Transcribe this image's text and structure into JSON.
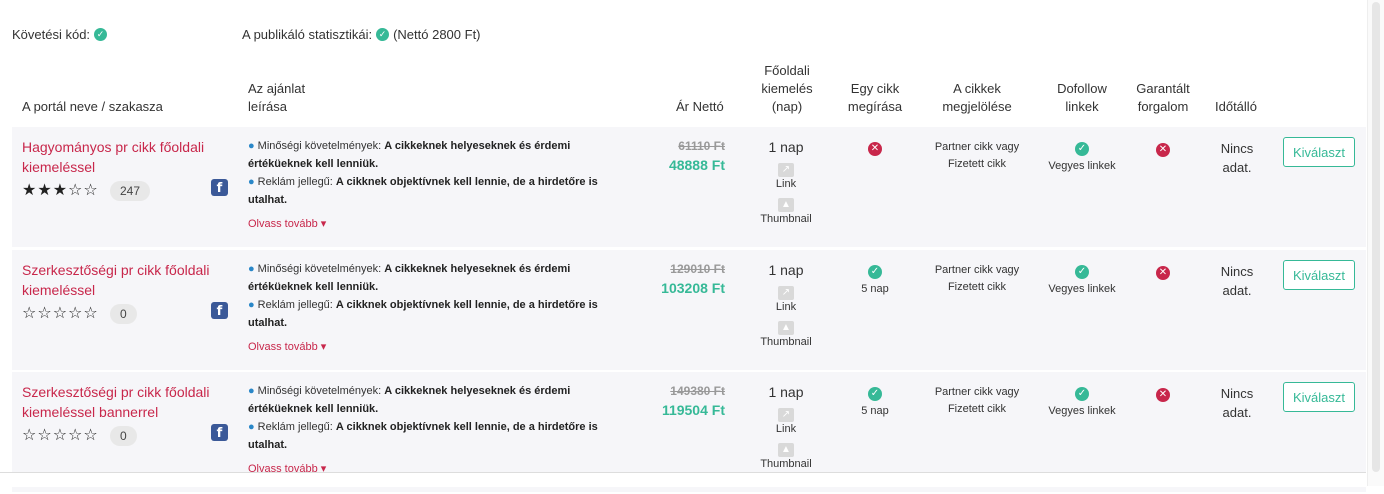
{
  "codes": {
    "tracking_label": "Követési kód:",
    "stats_label": "A publikáló statisztikái:",
    "stats_value": "(Nettó 2800 Ft)"
  },
  "headers": {
    "portal": "A portál neve / szakasza",
    "desc_line1": "Az ajánlat",
    "desc_line2": "leírása",
    "price": "Ár Nettó",
    "feat_line1": "Főoldali",
    "feat_line2": "kiemelés",
    "feat_line3": "(nap)",
    "write_line1": "Egy cikk",
    "write_line2": "megírása",
    "mark_line1": "A cikkek",
    "mark_line2": "megjelölése",
    "dofollow_line1": "Dofollow",
    "dofollow_line2": "linkek",
    "traffic_line1": "Garantált",
    "traffic_line2": "forgalom",
    "validity": "Időtálló"
  },
  "rows": [
    {
      "portal": "Hagyományos pr cikk főoldali kiemeléssel",
      "stars": "★★★☆☆",
      "rating_count": "247",
      "desc1_label": "Minőségi követelmények:",
      "desc1_text": "A cikkeknek helyeseknek és érdemi értéküeknek kell lenniük.",
      "desc2_label": "Reklám jellegű:",
      "desc2_text": "A cikknek objektívnek kell lennie, de a hirdetőre is utalhat.",
      "more": "Olvass tovább ▾",
      "price_old": "61110 Ft",
      "price_new": "48888 Ft",
      "feat_days": "1 nap",
      "feat_link": "Link",
      "feat_thumb": "Thumbnail",
      "write_status": "no",
      "write_days": "",
      "mark_line1": "Partner cikk vagy",
      "mark_line2": "Fizetett cikk",
      "dofollow_text": "Vegyes linkek",
      "validity_line1": "Nincs",
      "validity_line2": "adat.",
      "button": "Kiválaszt"
    },
    {
      "portal": "Szerkesztőségi pr cikk főoldali kiemeléssel",
      "stars": "☆☆☆☆☆",
      "rating_count": "0",
      "desc1_label": "Minőségi követelmények:",
      "desc1_text": "A cikkeknek helyeseknek és érdemi értéküeknek kell lenniük.",
      "desc2_label": "Reklám jellegű:",
      "desc2_text": "A cikknek objektívnek kell lennie, de a hirdetőre is utalhat.",
      "more": "Olvass tovább ▾",
      "price_old": "129010 Ft",
      "price_new": "103208 Ft",
      "feat_days": "1 nap",
      "feat_link": "Link",
      "feat_thumb": "Thumbnail",
      "write_status": "yes",
      "write_days": "5 nap",
      "mark_line1": "Partner cikk vagy",
      "mark_line2": "Fizetett cikk",
      "dofollow_text": "Vegyes linkek",
      "validity_line1": "Nincs",
      "validity_line2": "adat.",
      "button": "Kiválaszt"
    },
    {
      "portal": "Szerkesztőségi pr cikk főoldali kiemeléssel bannerrel",
      "stars": "☆☆☆☆☆",
      "rating_count": "0",
      "desc1_label": "Minőségi követelmények:",
      "desc1_text": "A cikkeknek helyeseknek és érdemi értéküeknek kell lenniük.",
      "desc2_label": "Reklám jellegű:",
      "desc2_text": "A cikknek objektívnek kell lennie, de a hirdetőre is utalhat.",
      "more": "Olvass tovább ▾",
      "price_old": "149380 Ft",
      "price_new": "119504 Ft",
      "feat_days": "1 nap",
      "feat_link": "Link",
      "feat_thumb": "Thumbnail",
      "write_status": "yes",
      "write_days": "5 nap",
      "mark_line1": "Partner cikk vagy",
      "mark_line2": "Fizetett cikk",
      "dofollow_text": "Vegyes linkek",
      "validity_line1": "Nincs",
      "validity_line2": "adat.",
      "button": "Kiválaszt"
    }
  ]
}
